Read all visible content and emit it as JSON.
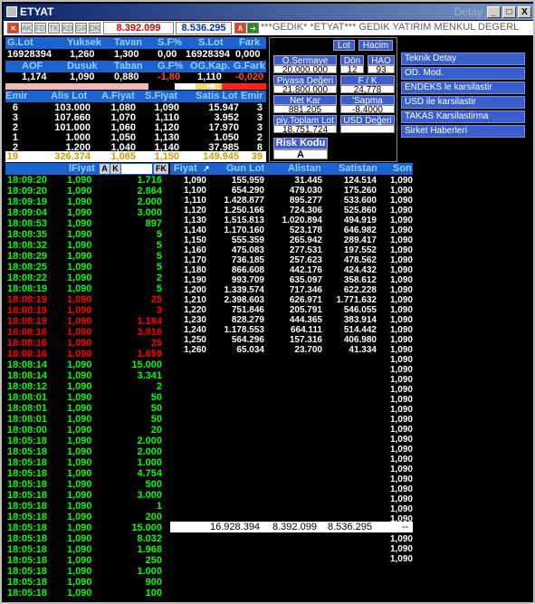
{
  "window": {
    "title": "ETYAT",
    "detail_label": "Detay",
    "buttons": [
      "_",
      "□",
      "X"
    ]
  },
  "toolbar": {
    "small_buttons": [
      "AK",
      "FD",
      "TK",
      "KD",
      "GR",
      "DK"
    ],
    "price_red": "8.392.099",
    "price_blue": "8.536.295",
    "a_label": "A",
    "ticker": "***GEDIK* *ETYAT*** GEDIK YATIRIM MENKUL DEGERL"
  },
  "summary": {
    "row1_headers": [
      "G.Lot",
      "Yuksek",
      "Tavan",
      "S.F%",
      "S.Lot",
      "Fark"
    ],
    "row1_values": [
      "16928394",
      "1,260",
      "1,300",
      "0,00",
      "16928394",
      "0,000"
    ],
    "row2_headers": [
      "AOF",
      "Dusuk",
      "Taban",
      "G.F%",
      "OG.Kap.",
      "G.Fark"
    ],
    "row2_values": [
      "1,174",
      "1,090",
      "0,880",
      "-1,80",
      "1,110",
      "-0,020"
    ]
  },
  "panel": {
    "lot": "Lot",
    "hacim": "Hacim",
    "o_sermaye": "Ö.Sermaye",
    "o_sermaye_val": "20.000.000",
    "don": "Dön",
    "don_val": "12",
    "hao": "HAO",
    "hao_val": "93",
    "piyasa": "Piyasa Değeri",
    "piyasa_val": "21.800.000",
    "fk": "F / K",
    "fk_val": "24,778",
    "net_kar": "Net Kar",
    "net_kar_val": "881.205",
    "sapma": "'Sapma",
    "sapma_val": "-8.4000",
    "toplam_lot": "piy.Toplam Lot",
    "toplam_lot_val": "18.751.724",
    "usd": "USD Değeri",
    "risk": "Risk Kodu",
    "risk_val": "A"
  },
  "right_menu": [
    "Teknik Detay",
    "OD. Mod.",
    "ENDEKS le karsilastir",
    "USD ile karsilastir",
    "TAKAS Karsilastirma",
    "Sirket Haberleri"
  ],
  "orderbook": {
    "headers": [
      "Emir",
      "Alis Lot",
      "A.Fiyat",
      "S.Fiyat",
      "Satis Lot",
      "Emir"
    ],
    "rows": [
      [
        "6",
        "103.000",
        "1,080",
        "1,090",
        "15.947",
        "3"
      ],
      [
        "3",
        "107.660",
        "1,070",
        "1,110",
        "3.952",
        "3"
      ],
      [
        "2",
        "101.000",
        "1,060",
        "1,120",
        "17.970",
        "3"
      ],
      [
        "1",
        "1.000",
        "1,050",
        "1,130",
        "1.050",
        "2"
      ],
      [
        "2",
        "1.200",
        "1,040",
        "1,140",
        "37.985",
        "8"
      ]
    ],
    "total": [
      "19",
      "326.374",
      "1,065",
      "1,150",
      "149.945",
      "39"
    ]
  },
  "trades_header": {
    "fiyat": "lFiyat",
    "a": "A",
    "k": "K",
    "fk": "FK"
  },
  "trades": [
    {
      "t": "18:09:20",
      "p": "1,090",
      "q": "1.716",
      "c": "g"
    },
    {
      "t": "18:09:20",
      "p": "1,090",
      "q": "2.864",
      "c": "g"
    },
    {
      "t": "18:09:19",
      "p": "1,090",
      "q": "2.000",
      "c": "g"
    },
    {
      "t": "18:09:04",
      "p": "1,090",
      "q": "3.000",
      "c": "g"
    },
    {
      "t": "18:08:53",
      "p": "1,090",
      "q": "897",
      "c": "g"
    },
    {
      "t": "18:08:35",
      "p": "1,090",
      "q": "5",
      "c": "g"
    },
    {
      "t": "18:08:32",
      "p": "1,090",
      "q": "5",
      "c": "g"
    },
    {
      "t": "18:08:29",
      "p": "1,090",
      "q": "5",
      "c": "g"
    },
    {
      "t": "18:08:25",
      "p": "1,090",
      "q": "5",
      "c": "g"
    },
    {
      "t": "18:08:22",
      "p": "1,090",
      "q": "2",
      "c": "g"
    },
    {
      "t": "18:08:19",
      "p": "1,090",
      "q": "5",
      "c": "g"
    },
    {
      "t": "18:08:19",
      "p": "1,090",
      "q": "25",
      "c": "r"
    },
    {
      "t": "18:08:19",
      "p": "1,090",
      "q": "3",
      "c": "r"
    },
    {
      "t": "18:08:19",
      "p": "1,090",
      "q": "1.184",
      "c": "r"
    },
    {
      "t": "18:08:16",
      "p": "1,090",
      "q": "3.816",
      "c": "r"
    },
    {
      "t": "18:08:16",
      "p": "1,090",
      "q": "25",
      "c": "r"
    },
    {
      "t": "18:08:16",
      "p": "1,090",
      "q": "1.659",
      "c": "r"
    },
    {
      "t": "18:08:14",
      "p": "1,090",
      "q": "15.000",
      "c": "g"
    },
    {
      "t": "18:08:14",
      "p": "1,090",
      "q": "3.341",
      "c": "g"
    },
    {
      "t": "18:08:12",
      "p": "1,090",
      "q": "2",
      "c": "g"
    },
    {
      "t": "18:08:01",
      "p": "1,090",
      "q": "50",
      "c": "g"
    },
    {
      "t": "18:08:01",
      "p": "1,090",
      "q": "50",
      "c": "g"
    },
    {
      "t": "18:08:01",
      "p": "1,090",
      "q": "50",
      "c": "g"
    },
    {
      "t": "18:08:00",
      "p": "1,090",
      "q": "20",
      "c": "g"
    },
    {
      "t": "18:05:18",
      "p": "1,090",
      "q": "2.000",
      "c": "g"
    },
    {
      "t": "18:05:18",
      "p": "1,090",
      "q": "2.000",
      "c": "g"
    },
    {
      "t": "18:05:18",
      "p": "1,090",
      "q": "1.000",
      "c": "g"
    },
    {
      "t": "18:05:18",
      "p": "1,090",
      "q": "4.754",
      "c": "g"
    },
    {
      "t": "18:05:18",
      "p": "1,090",
      "q": "500",
      "c": "g"
    },
    {
      "t": "18:05:18",
      "p": "1,090",
      "q": "3.000",
      "c": "g"
    },
    {
      "t": "18:05:18",
      "p": "1,090",
      "q": "1",
      "c": "g"
    },
    {
      "t": "18:05:18",
      "p": "1,090",
      "q": "200",
      "c": "g"
    },
    {
      "t": "18:05:18",
      "p": "1,090",
      "q": "15.000",
      "c": "g"
    },
    {
      "t": "18:05:18",
      "p": "1,090",
      "q": "8.032",
      "c": "g"
    },
    {
      "t": "18:05:18",
      "p": "1,090",
      "q": "1.968",
      "c": "g"
    },
    {
      "t": "18:05:18",
      "p": "1,090",
      "q": "250",
      "c": "g"
    },
    {
      "t": "18:05:18",
      "p": "1,090",
      "q": "1.000",
      "c": "g"
    },
    {
      "t": "18:05:18",
      "p": "1,090",
      "q": "900",
      "c": "g"
    },
    {
      "t": "18:05:18",
      "p": "1,090",
      "q": "100",
      "c": "g"
    }
  ],
  "depth_header": [
    "Fiyat",
    "Gun Lot",
    "Alistan",
    "Satistan",
    "Son"
  ],
  "depth": [
    [
      "1,090",
      "155.959",
      "31.445",
      "124.514",
      "1,090"
    ],
    [
      "1,100",
      "654.290",
      "479.030",
      "175.260",
      "1,090"
    ],
    [
      "1,110",
      "1.428.877",
      "895.277",
      "533.600",
      "1,090"
    ],
    [
      "1,120",
      "1.250.166",
      "724.306",
      "525.860",
      "1,090"
    ],
    [
      "1,130",
      "1.515.813",
      "1.020.894",
      "494.919",
      "1,090"
    ],
    [
      "1,140",
      "1.170.160",
      "523.178",
      "646.982",
      "1,090"
    ],
    [
      "1,150",
      "555.359",
      "265.942",
      "289.417",
      "1,090"
    ],
    [
      "1,160",
      "475.083",
      "277.531",
      "197.552",
      "1,090"
    ],
    [
      "1,170",
      "736.185",
      "257.623",
      "478.562",
      "1,090"
    ],
    [
      "1,180",
      "866.608",
      "442.176",
      "424.432",
      "1,090"
    ],
    [
      "1,190",
      "993.709",
      "635.097",
      "358.612",
      "1,090"
    ],
    [
      "1,200",
      "1.339.574",
      "717.346",
      "622.228",
      "1,090"
    ],
    [
      "1,210",
      "2.398.603",
      "626.971",
      "1.771.632",
      "1,090"
    ],
    [
      "1,220",
      "751.846",
      "205.791",
      "546.055",
      "1,090"
    ],
    [
      "1,230",
      "828.279",
      "444.365",
      "383.914",
      "1,090"
    ],
    [
      "1,240",
      "1.178.553",
      "664.111",
      "514.442",
      "1,090"
    ],
    [
      "1,250",
      "564.296",
      "157.316",
      "406.980",
      "1,090"
    ],
    [
      "1,260",
      "65.034",
      "23.700",
      "41.334",
      "1,090"
    ]
  ],
  "son_extra": [
    "1,090",
    "1,090",
    "1,090",
    "1,090",
    "1,090",
    "1,090",
    "1,090",
    "1,090",
    "1,090",
    "1,090",
    "1,090",
    "1,090",
    "1,090",
    "1,090",
    "1,090",
    "1,090",
    "1,090",
    "1,090",
    "1,090",
    "1,090",
    "1,090"
  ],
  "totals": {
    "lot": "16.928.394",
    "alis": "8.392.099",
    "satis": "8.536.295",
    "dash": "--"
  }
}
